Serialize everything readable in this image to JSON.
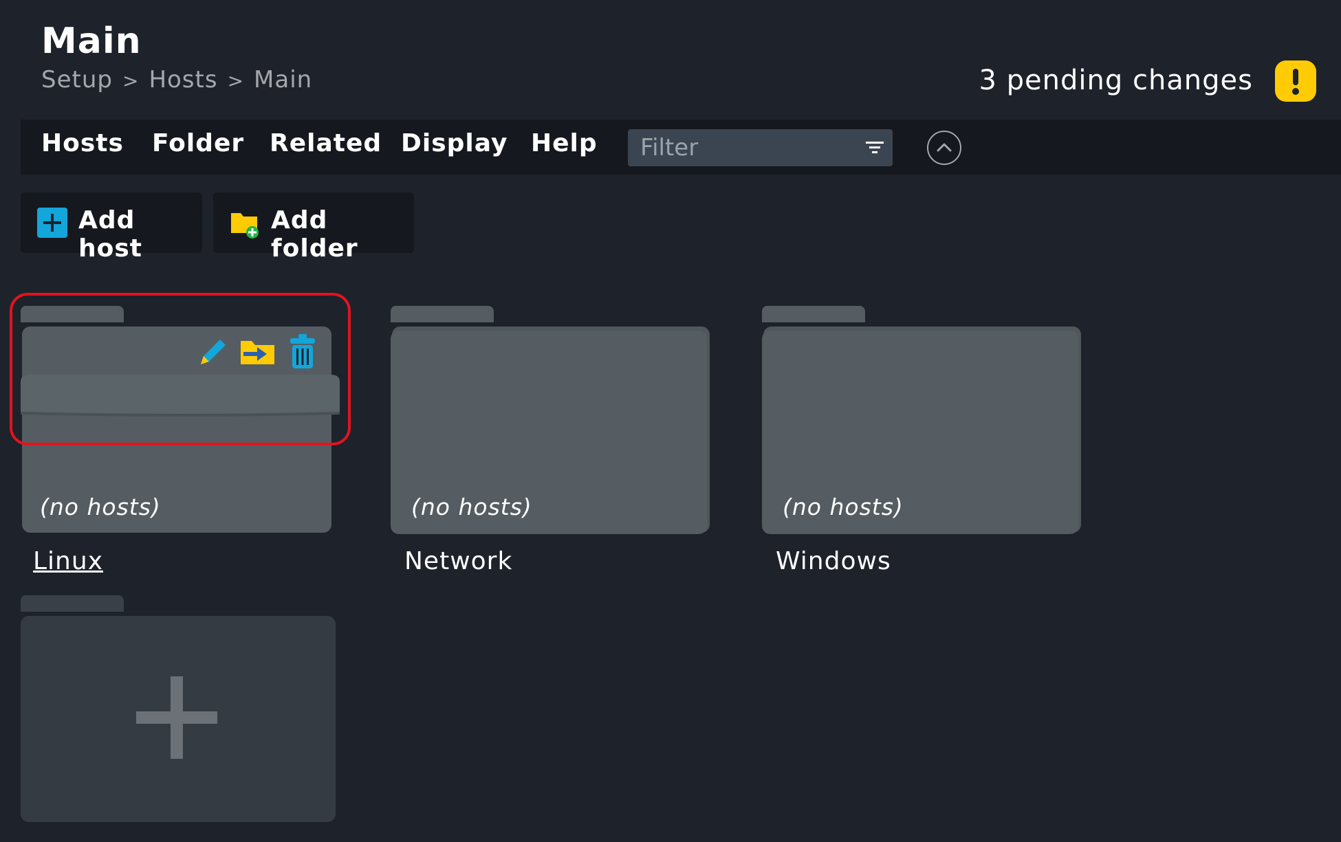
{
  "header": {
    "title": "Main",
    "breadcrumb": [
      "Setup",
      "Hosts",
      "Main"
    ],
    "breadcrumb_separator": ">",
    "pending_changes": "3 pending changes",
    "pending_icon": "exclamation-icon",
    "warning_color": "#ffcb05"
  },
  "menu": {
    "items": [
      "Hosts",
      "Folder",
      "Related",
      "Display",
      "Help"
    ],
    "filter_placeholder": "Filter",
    "filter_icon": "filter-lines-icon",
    "collapse_icon": "chevron-up-circle-icon"
  },
  "actions": {
    "add_host": "Add host",
    "add_folder": "Add folder"
  },
  "folders": [
    {
      "name": "Linux",
      "status": "(no hosts)",
      "hovered": true,
      "icons": [
        "edit-pencil-icon",
        "move-folder-icon",
        "delete-trash-icon"
      ]
    },
    {
      "name": "Network",
      "status": "(no hosts)"
    },
    {
      "name": "Windows",
      "status": "(no hosts)"
    }
  ],
  "new_folder_tile": {
    "icon": "plus-icon"
  },
  "colors": {
    "background": "#1e222b",
    "bar": "#15181e",
    "folder": "#555d62",
    "accent_blue": "#13a6da",
    "highlight": "#e0141e"
  }
}
